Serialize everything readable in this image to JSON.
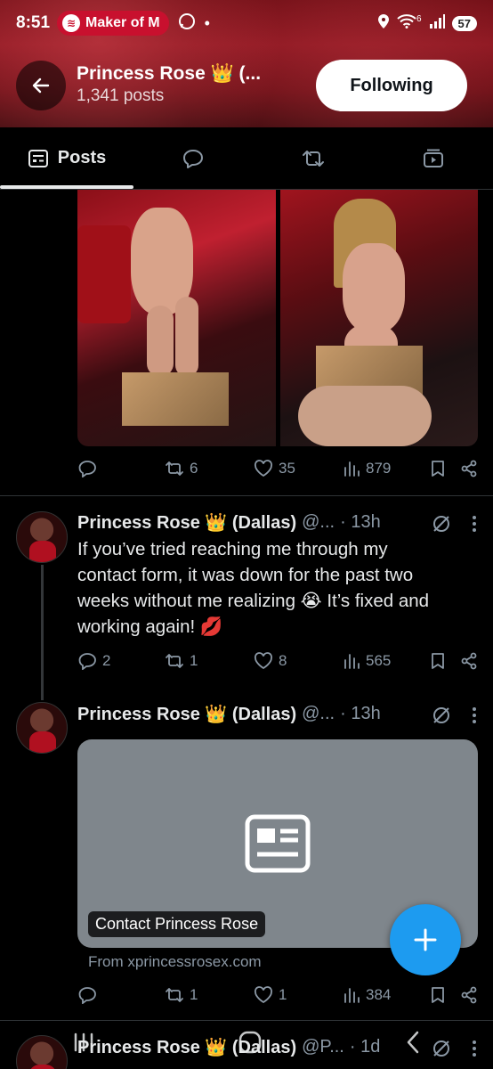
{
  "status_bar": {
    "time": "8:51",
    "media_app_label": "Maker of M",
    "battery": "57",
    "signal_label": "6"
  },
  "profile": {
    "name": "Princess Rose 👑 (...",
    "post_count": "1,341 posts",
    "follow_button": "Following"
  },
  "tabs": [
    {
      "label": "Posts",
      "icon": "posts-icon",
      "active": true
    },
    {
      "label": "",
      "icon": "replies-icon"
    },
    {
      "label": "",
      "icon": "reposts-icon"
    },
    {
      "label": "",
      "icon": "media-icon"
    }
  ],
  "post1": {
    "stats": {
      "replies": "",
      "reposts": "6",
      "likes": "35",
      "views": "879"
    }
  },
  "post2": {
    "name": "Princess Rose 👑 (Dallas)",
    "handle": "@...",
    "time": "· 13h",
    "text_line1": "If you’ve tried reaching me through my",
    "text_line2": "contact form, it was down for the past two",
    "text_line3": "weeks without me realizing 😭 It’s fixed and",
    "text_line4": "working again! 💋",
    "stats": {
      "replies": "2",
      "reposts": "1",
      "likes": "8",
      "views": "565"
    }
  },
  "post3": {
    "name": "Princess Rose 👑 (Dallas)",
    "handle": "@...",
    "time": "· 13h",
    "card_title": "Contact Princess Rose",
    "card_source": "From xprincessrosex.com",
    "stats": {
      "replies": "",
      "reposts": "1",
      "likes": "1",
      "views": "384"
    }
  },
  "post4": {
    "name": "Princess Rose 👑 (Dallas)",
    "handle": "@P...",
    "time": "· 1d"
  },
  "colors": {
    "accent": "#1d9bf0",
    "muted": "#8b98a5",
    "banner": "#8a1620"
  }
}
